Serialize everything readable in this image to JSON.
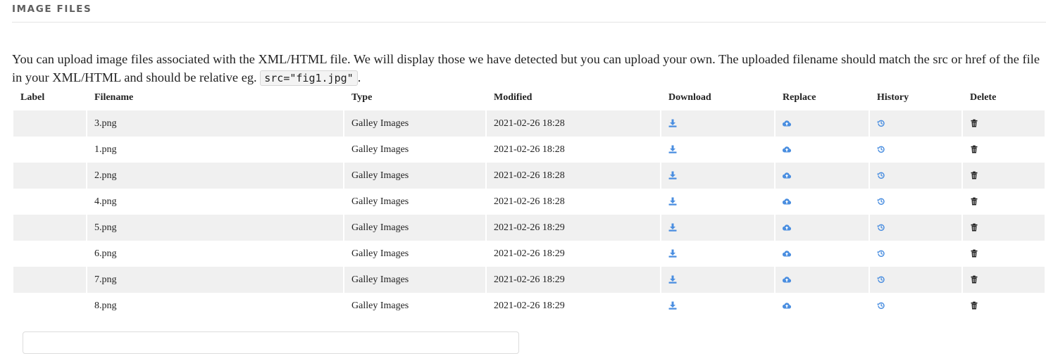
{
  "section": {
    "title": "IMAGE FILES",
    "intro_before": "You can upload image files associated with the XML/HTML file. We will display those we have detected but you can upload your own. The uploaded filename should match the src or href of the file in your XML/HTML and should be relative eg. ",
    "intro_code": "src=\"fig1.jpg\"",
    "intro_after": "."
  },
  "table": {
    "headers": {
      "label": "Label",
      "filename": "Filename",
      "type": "Type",
      "modified": "Modified",
      "download": "Download",
      "replace": "Replace",
      "history": "History",
      "delete": "Delete"
    },
    "rows": [
      {
        "label": "",
        "filename": "3.png",
        "type": "Galley Images",
        "modified": "2021-02-26 18:28"
      },
      {
        "label": "",
        "filename": "1.png",
        "type": "Galley Images",
        "modified": "2021-02-26 18:28"
      },
      {
        "label": "",
        "filename": "2.png",
        "type": "Galley Images",
        "modified": "2021-02-26 18:28"
      },
      {
        "label": "",
        "filename": "4.png",
        "type": "Galley Images",
        "modified": "2021-02-26 18:28"
      },
      {
        "label": "",
        "filename": "5.png",
        "type": "Galley Images",
        "modified": "2021-02-26 18:29"
      },
      {
        "label": "",
        "filename": "6.png",
        "type": "Galley Images",
        "modified": "2021-02-26 18:29"
      },
      {
        "label": "",
        "filename": "7.png",
        "type": "Galley Images",
        "modified": "2021-02-26 18:29"
      },
      {
        "label": "",
        "filename": "8.png",
        "type": "Galley Images",
        "modified": "2021-02-26 18:29"
      }
    ]
  },
  "icons": {
    "download": "download-icon",
    "replace": "cloud-upload-icon",
    "history": "history-icon",
    "delete": "trash-icon"
  },
  "colors": {
    "icon_accent": "#4a8ee0",
    "icon_dark": "#222222",
    "row_stripe": "#f0f0f0"
  }
}
